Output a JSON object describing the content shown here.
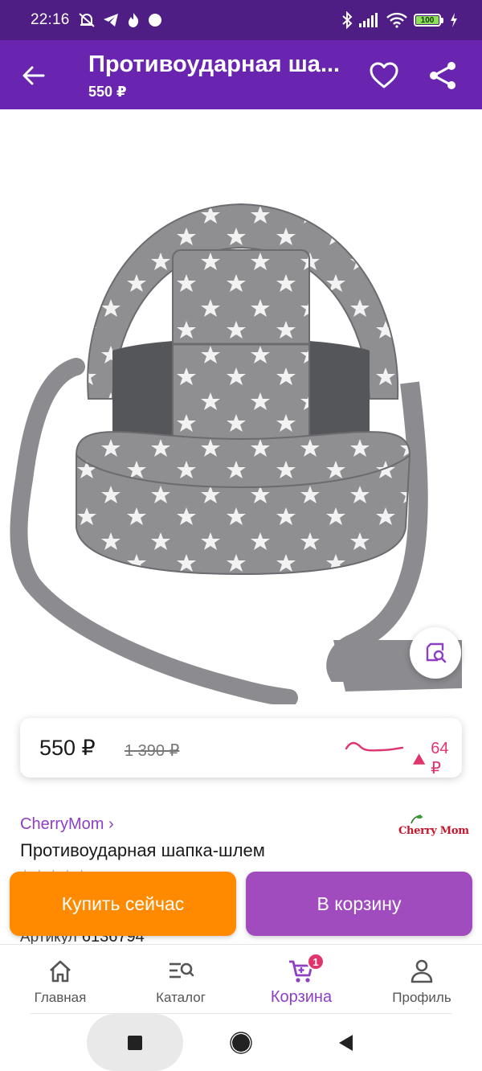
{
  "status_bar": {
    "time": "22:16",
    "battery": "100"
  },
  "app_bar": {
    "title": "Противоударная ша...",
    "subtitle": "550 ₽"
  },
  "price_card": {
    "price": "550 ₽",
    "old_price": "1 390 ₽",
    "delta": "64 ₽"
  },
  "product": {
    "brand": "CherryMom ›",
    "brand_logo_text": "Cherry Mom",
    "name": "Противоударная шапка-шлем",
    "article_label": "Артикул",
    "article_value": "6136794"
  },
  "actions": {
    "buy_now": "Купить сейчас",
    "add_to_cart": "В корзину"
  },
  "bottom_nav": {
    "items": [
      {
        "label": "Главная",
        "icon": "home-icon"
      },
      {
        "label": "Каталог",
        "icon": "catalog-search-icon"
      },
      {
        "label": "Корзина",
        "icon": "cart-icon",
        "badge": "1",
        "active": true
      },
      {
        "label": "Профиль",
        "icon": "profile-icon"
      }
    ]
  },
  "colors": {
    "status_bar": "#4e1e84",
    "app_bar": "#6a25b0",
    "buy_button": "#ff8a00",
    "cart_button": "#a04bbe",
    "accent": "#8e3fc4",
    "price_delta": "#e0356c"
  }
}
